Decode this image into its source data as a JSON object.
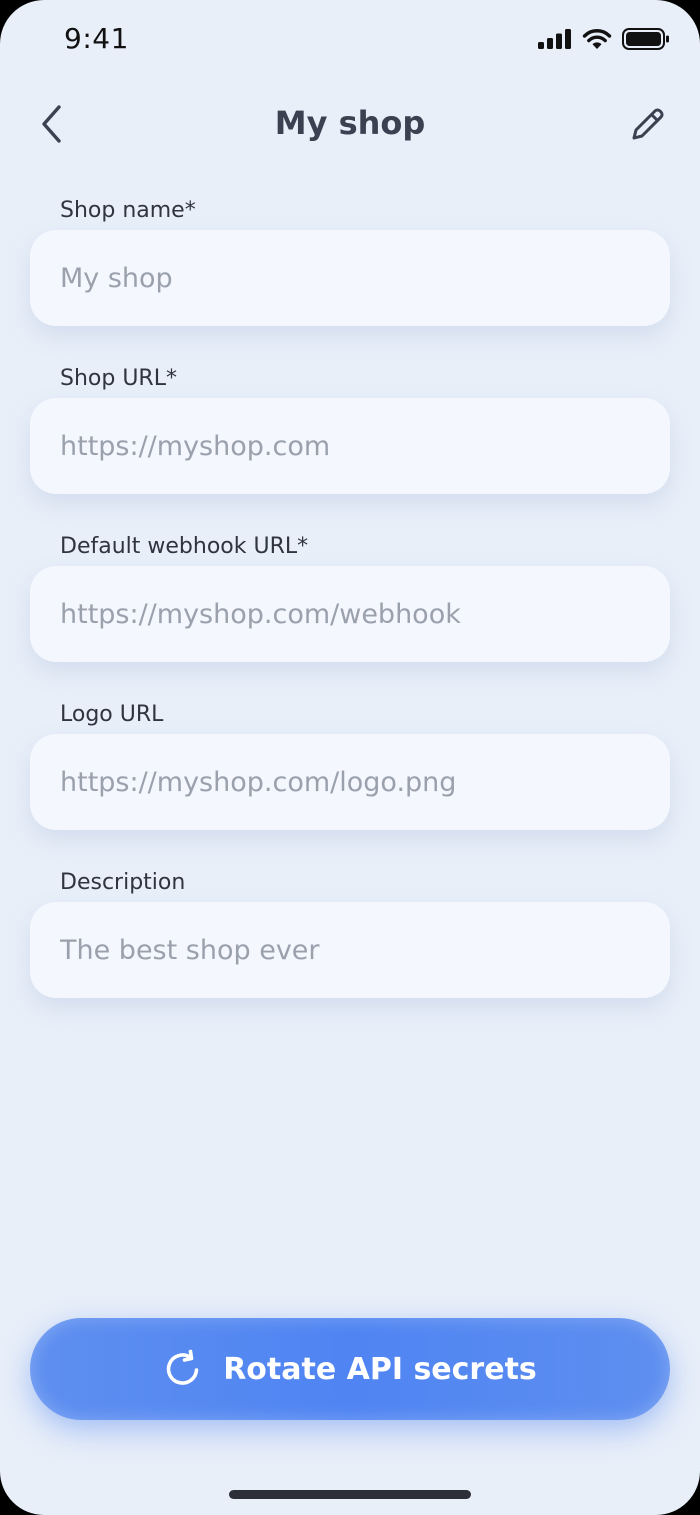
{
  "status_bar": {
    "time": "9:41",
    "icons": [
      "signal-icon",
      "wifi-icon",
      "battery-icon"
    ]
  },
  "header": {
    "title": "My shop",
    "back_icon": "chevron-left-icon",
    "edit_icon": "pencil-icon"
  },
  "form": {
    "fields": [
      {
        "label": "Shop name*",
        "value": "",
        "placeholder": "My shop"
      },
      {
        "label": "Shop URL*",
        "value": "",
        "placeholder": "https://myshop.com"
      },
      {
        "label": "Default webhook URL*",
        "value": "",
        "placeholder": "https://myshop.com/webhook"
      },
      {
        "label": "Logo URL",
        "value": "",
        "placeholder": "https://myshop.com/logo.png"
      },
      {
        "label": "Description",
        "value": "",
        "placeholder": "The best shop ever"
      }
    ]
  },
  "actions": {
    "rotate_label": "Rotate API secrets",
    "rotate_icon": "refresh-icon"
  },
  "colors": {
    "background": "#e8eff9",
    "input_background": "#f4f7fd",
    "accent": "#4f84f2",
    "title_text": "#3b4150",
    "placeholder_text": "#9aa1ad"
  }
}
